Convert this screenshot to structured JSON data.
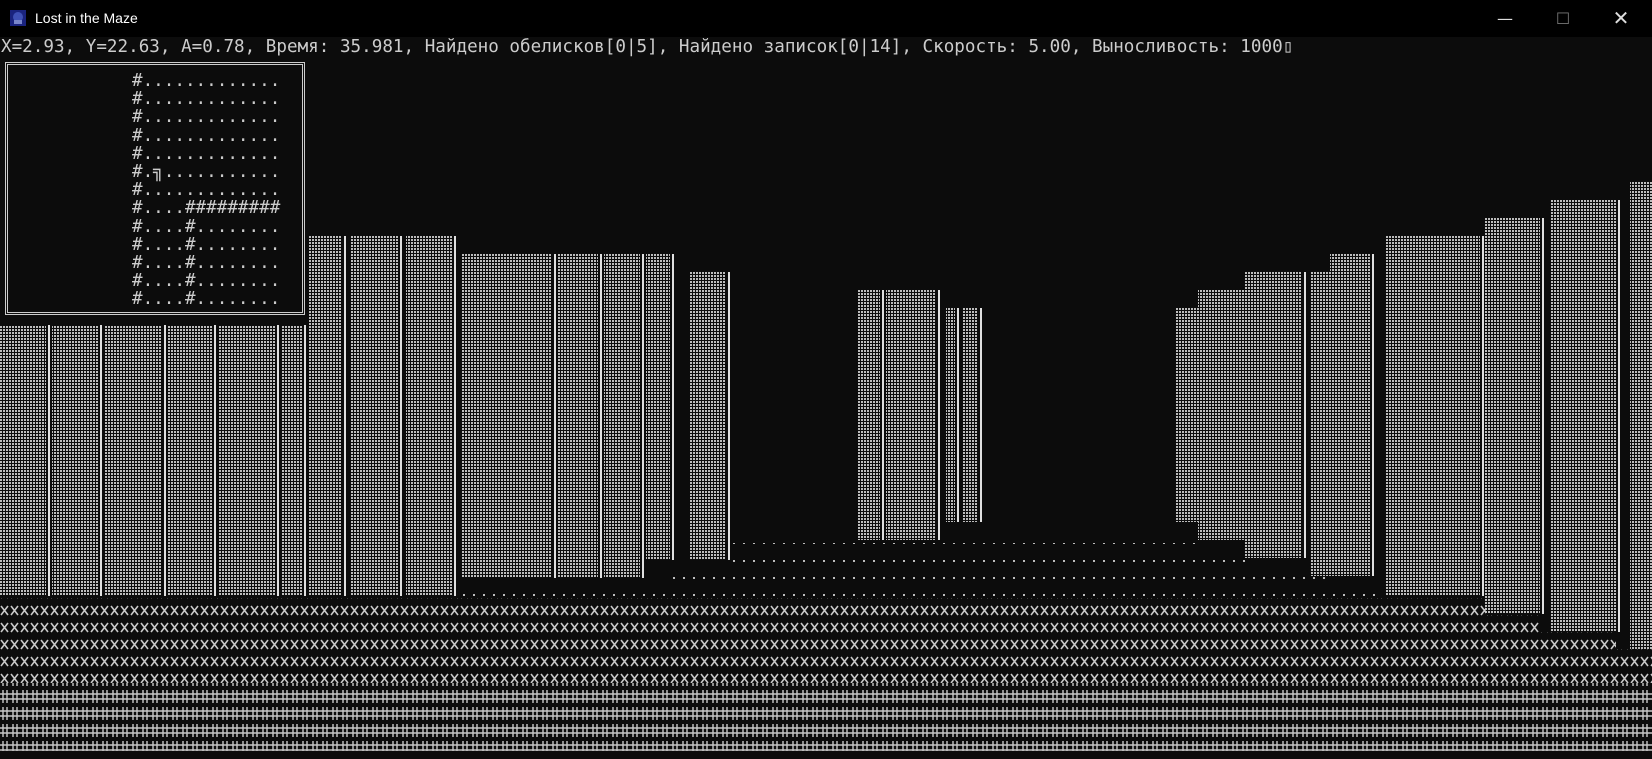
{
  "window": {
    "title": "Lost in the Maze",
    "minimize_glyph": "—",
    "maximize_glyph": "☐",
    "close_glyph": "✕"
  },
  "status": {
    "text": "X=2.93, Y=22.63, A=0.78, Время: 35.981, Найдено обелисков[0|5], Найдено записок[0|14], Скорость: 5.00, Выносливость: 1000▯",
    "x": 2.93,
    "y": 22.63,
    "angle": 0.78,
    "time": 35.981,
    "obelisks_found": "0|5",
    "notes_found": "0|14",
    "speed": 5.0,
    "stamina": 1000
  },
  "minimap": {
    "rows": [
      "#.............",
      "#.............",
      "#.............",
      "#.............",
      "#.............",
      "#.╗...........",
      "#.............",
      "#....#########",
      "#....#........",
      "#....#........",
      "#....#........",
      "#....#........",
      "#....#........"
    ]
  },
  "scene": {
    "wall_color": "#c8c8c8",
    "floor_row_chars": [
      ".",
      "x",
      "#"
    ],
    "background": "#0c0c0c"
  }
}
